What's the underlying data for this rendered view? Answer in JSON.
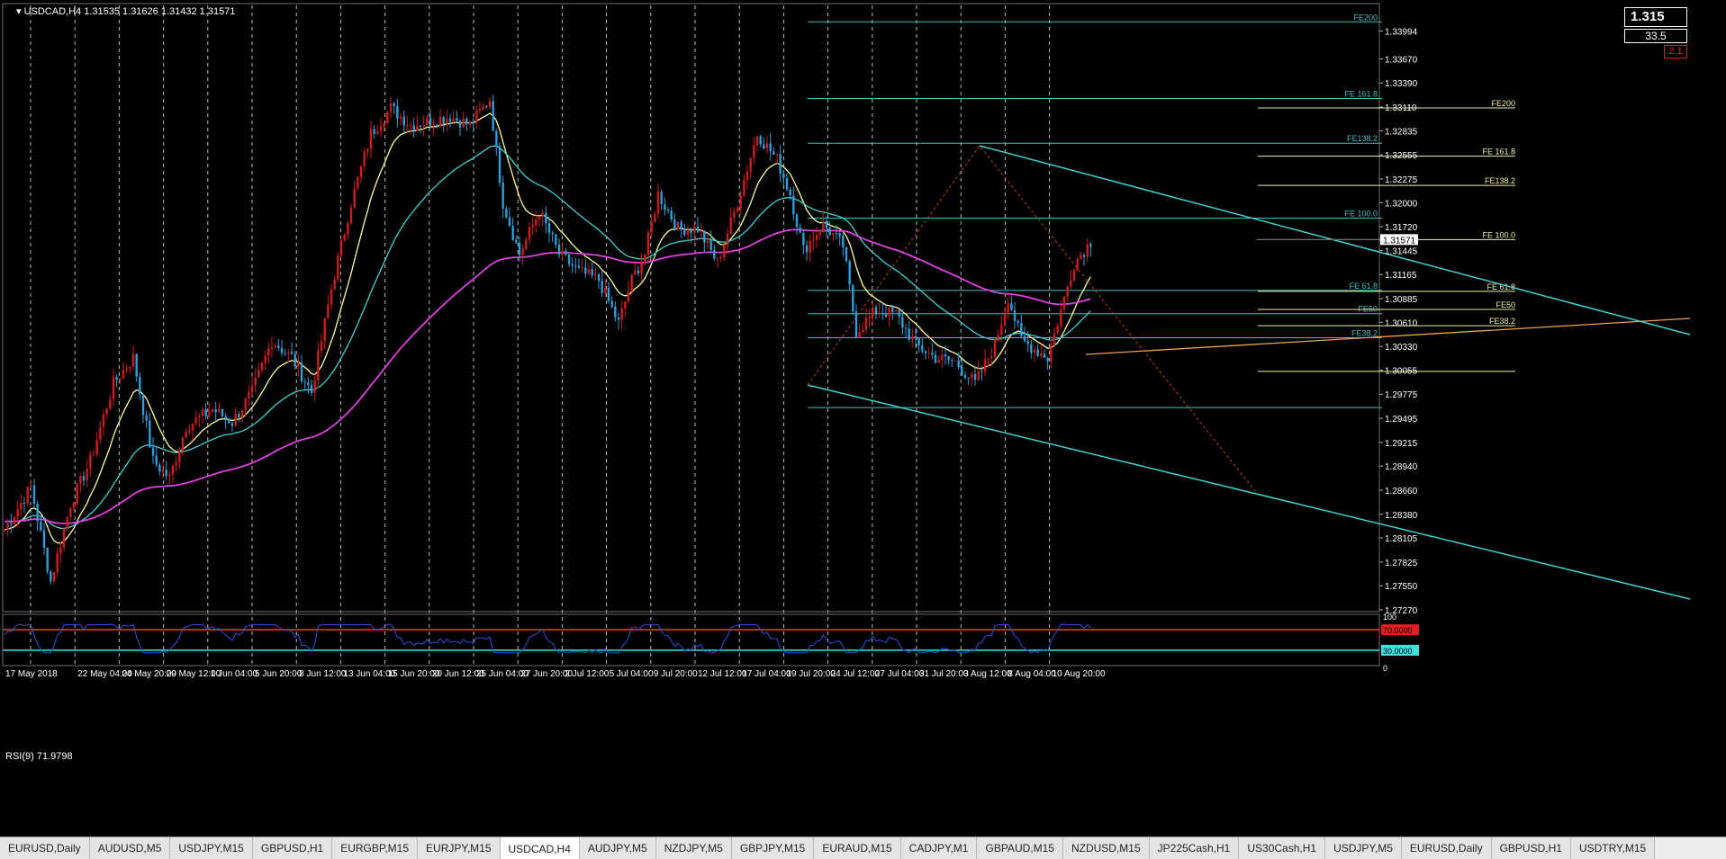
{
  "window": {
    "title": "USDCAD,H4  1.31535 1.31626 1.31432 1.31571"
  },
  "indicator": {
    "rsi_label": "RSI(9) 71.9798",
    "rsi_levels": [
      "70.0000",
      "30.0000"
    ],
    "rsi_scale": [
      "100",
      "0"
    ]
  },
  "price_widget": {
    "price": "1.315",
    "spread": "33.5",
    "value": "2.1"
  },
  "colors": {
    "background": "#000000",
    "bull": "#d01c1c",
    "bear": "#2f9fd9",
    "ema_fast": "#ffff99",
    "ema_mid": "#40d0d0",
    "ema_slow": "#e040e0",
    "channel": "#40d0d0",
    "fib_cyan": "#40c0c0",
    "fib_yellow": "#f0f0a0",
    "rsi_line": "#3050e0",
    "rsi_upper": "#e02020",
    "rsi_lower": "#40e0e0"
  },
  "chart_data": {
    "type": "candlestick",
    "symbol": "USDCAD,H4",
    "ohlc_header": {
      "open": 1.31535,
      "high": 1.31626,
      "low": 1.31432,
      "close": 1.31571
    },
    "y_ticks": [
      "1.33994",
      "1.33670",
      "1.33390",
      "1.33110",
      "1.32835",
      "1.32555",
      "1.32275",
      "1.32000",
      "1.31720",
      "1.31445",
      "1.31165",
      "1.30885",
      "1.30610",
      "1.30330",
      "1.30055",
      "1.29775",
      "1.29495",
      "1.29215",
      "1.28940",
      "1.28660",
      "1.28380",
      "1.28105",
      "1.27825",
      "1.27550",
      "1.27270"
    ],
    "ylim": [
      1.2727,
      1.3427
    ],
    "x_labels": [
      "17 May 2018",
      "22 May 04:00",
      "24 May 20:00",
      "29 May 12:00",
      "1 Jun 04:00",
      "5 Jun 20:00",
      "8 Jun 12:00",
      "13 Jun 04:00",
      "15 Jun 20:00",
      "20 Jun 12:00",
      "25 Jun 04:00",
      "27 Jun 20:00",
      "2 Jul 12:00",
      "5 Jul 04:00",
      "9 Jul 20:00",
      "12 Jul 12:00",
      "17 Jul 04:00",
      "19 Jul 20:00",
      "24 Jul 12:00",
      "27 Jul 04:00",
      "31 Jul 20:00",
      "3 Aug 12:00",
      "8 Aug 04:00",
      "10 Aug 20:00"
    ],
    "current_price": "1.31571",
    "price_path": [
      [
        0,
        1.282
      ],
      [
        8,
        1.287
      ],
      [
        14,
        1.276
      ],
      [
        20,
        1.285
      ],
      [
        26,
        1.29
      ],
      [
        33,
        1.299
      ],
      [
        39,
        1.302
      ],
      [
        45,
        1.29
      ],
      [
        50,
        1.288
      ],
      [
        55,
        1.294
      ],
      [
        63,
        1.296
      ],
      [
        69,
        1.2945
      ],
      [
        75,
        1.298
      ],
      [
        81,
        1.304
      ],
      [
        87,
        1.302
      ],
      [
        93,
        1.298
      ],
      [
        99,
        1.31
      ],
      [
        105,
        1.32
      ],
      [
        111,
        1.328
      ],
      [
        117,
        1.331
      ],
      [
        123,
        1.329
      ],
      [
        129,
        1.3295
      ],
      [
        135,
        1.33
      ],
      [
        141,
        1.329
      ],
      [
        147,
        1.332
      ],
      [
        151,
        1.32
      ],
      [
        156,
        1.314
      ],
      [
        162,
        1.319
      ],
      [
        168,
        1.314
      ],
      [
        174,
        1.312
      ],
      [
        180,
        1.311
      ],
      [
        186,
        1.306
      ],
      [
        190,
        1.311
      ],
      [
        194,
        1.314
      ],
      [
        198,
        1.321
      ],
      [
        204,
        1.317
      ],
      [
        210,
        1.317
      ],
      [
        216,
        1.313
      ],
      [
        222,
        1.32
      ],
      [
        228,
        1.328
      ],
      [
        234,
        1.325
      ],
      [
        238,
        1.321
      ],
      [
        242,
        1.3145
      ],
      [
        248,
        1.3175
      ],
      [
        254,
        1.315
      ],
      [
        258,
        1.305
      ],
      [
        264,
        1.3075
      ],
      [
        270,
        1.307
      ],
      [
        276,
        1.3035
      ],
      [
        282,
        1.302
      ],
      [
        288,
        1.3015
      ],
      [
        294,
        1.299
      ],
      [
        300,
        1.3035
      ],
      [
        304,
        1.309
      ],
      [
        308,
        1.304
      ],
      [
        312,
        1.303
      ],
      [
        316,
        1.302
      ],
      [
        320,
        1.3075
      ],
      [
        324,
        1.313
      ],
      [
        329,
        1.3155
      ]
    ],
    "series": [
      {
        "name": "",
        "type": "moving_average",
        "color": "#ffff99"
      },
      {
        "name": "",
        "type": "moving_average",
        "color": "#40d0d0"
      },
      {
        "name": "",
        "type": "moving_average",
        "color": "#e040e0"
      }
    ],
    "fib_labels_cyan": [
      "FE200",
      "FE 161.8",
      "FE138.2",
      "FE 100.0",
      "FE 61.8",
      "FE50",
      "FE38.2"
    ],
    "fib_labels_yellow": [
      "FE200",
      "FE 161.8",
      "FE138.2",
      "FE 100.0",
      "FE 61.8",
      "FE50",
      "FE38.2"
    ],
    "fib_cyan_levels": [
      1.341,
      1.3321,
      1.3269,
      1.3182,
      1.3098,
      1.3071,
      1.3043,
      1.2962
    ],
    "fib_yellow_levels": [
      1.331,
      1.3254,
      1.322,
      1.3157,
      1.3097,
      1.3076,
      1.3057,
      1.3004
    ],
    "rsi": {
      "name": "RSI(9)",
      "last": 71.9798,
      "levels": [
        70,
        30
      ],
      "range": [
        0,
        100
      ]
    }
  },
  "tabs": [
    "EURUSD,Daily",
    "AUDUSD,M5",
    "USDJPY,M15",
    "GBPUSD,H1",
    "EURGBP,M15",
    "EURJPY,M15",
    "USDCAD,H4",
    "AUDJPY,M5",
    "NZDJPY,M5",
    "GBPJPY,M15",
    "EURAUD,M15",
    "CADJPY,M1",
    "GBPAUD,M15",
    "NZDUSD,M15",
    "JP225Cash,H1",
    "US30Cash,H1",
    "USDJPY,M5",
    "EURUSD,Daily",
    "GBPUSD,H1",
    "USDTRY,M15"
  ],
  "active_tab": "USDCAD,H4"
}
